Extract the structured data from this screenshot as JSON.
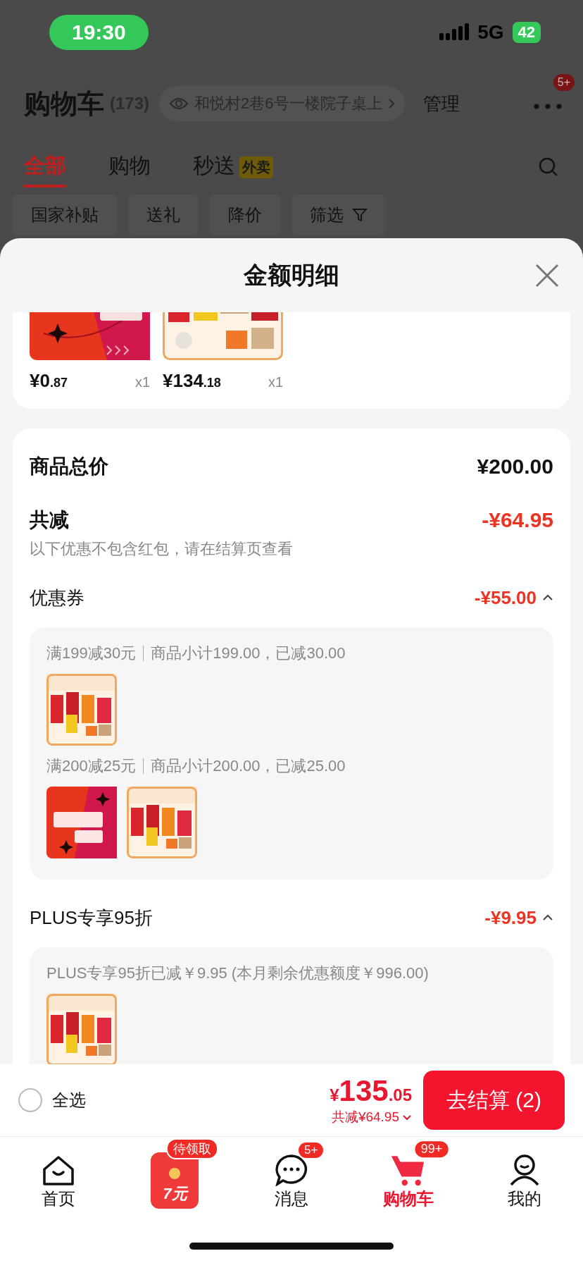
{
  "status_bar": {
    "time": "19:30",
    "network": "5G",
    "battery": "42"
  },
  "header": {
    "title": "购物车",
    "count": "(173)",
    "address": "和悦村2巷6号一楼院子桌上",
    "manage": "管理",
    "more_badge": "5+"
  },
  "tabs": [
    {
      "label": "全部",
      "selected": true
    },
    {
      "label": "购物",
      "selected": false
    },
    {
      "label": "秒送",
      "selected": false,
      "badge": "外卖"
    }
  ],
  "chips": [
    {
      "label": "国家补贴",
      "kind": "plain"
    },
    {
      "label": "送礼",
      "kind": "plain"
    },
    {
      "label": "降价",
      "kind": "plain"
    },
    {
      "label": "筛选",
      "kind": "filter"
    }
  ],
  "sheet": {
    "title": "金额明细",
    "items": [
      {
        "price_int": "¥0",
        "price_dec": ".87",
        "qty": "x1"
      },
      {
        "price_int": "¥134",
        "price_dec": ".18",
        "qty": "x1"
      }
    ],
    "total_label": "商品总价",
    "total_value": "¥200.00",
    "discount_label": "共减",
    "discount_value": "-¥64.95",
    "discount_note": "以下优惠不包含红包，请在结算页查看",
    "sections": [
      {
        "label": "优惠券",
        "amount": "-¥55.00",
        "expanded": true,
        "groups": [
          {
            "condition": "满199减30元",
            "detail": "商品小计199.00，已减30.00"
          },
          {
            "condition": "满200减25元",
            "detail": "商品小计200.00，已减25.00"
          }
        ]
      },
      {
        "label": "PLUS专享95折",
        "amount": "-¥9.95",
        "expanded": true,
        "groups": [
          {
            "text": "PLUS专享95折已减￥9.95 (本月剩余优惠额度￥996.00)"
          }
        ]
      }
    ]
  },
  "checkout": {
    "select_all": {
      "label": "全选",
      "checked": false
    },
    "currency": "¥",
    "total_int": "135",
    "total_dec": ".05",
    "savings": "共减¥64.95",
    "button": "去结算 (2)"
  },
  "tab_bar": [
    {
      "kind": "home",
      "label": "首页",
      "selected": false
    },
    {
      "kind": "redpacket",
      "promo": "7元",
      "badge": "待领取",
      "selected": false
    },
    {
      "kind": "chat",
      "label": "消息",
      "badge": "5+",
      "selected": false
    },
    {
      "kind": "cart",
      "label": "购物车",
      "badge": "99+",
      "selected": true
    },
    {
      "kind": "profile",
      "label": "我的",
      "selected": false
    }
  ]
}
